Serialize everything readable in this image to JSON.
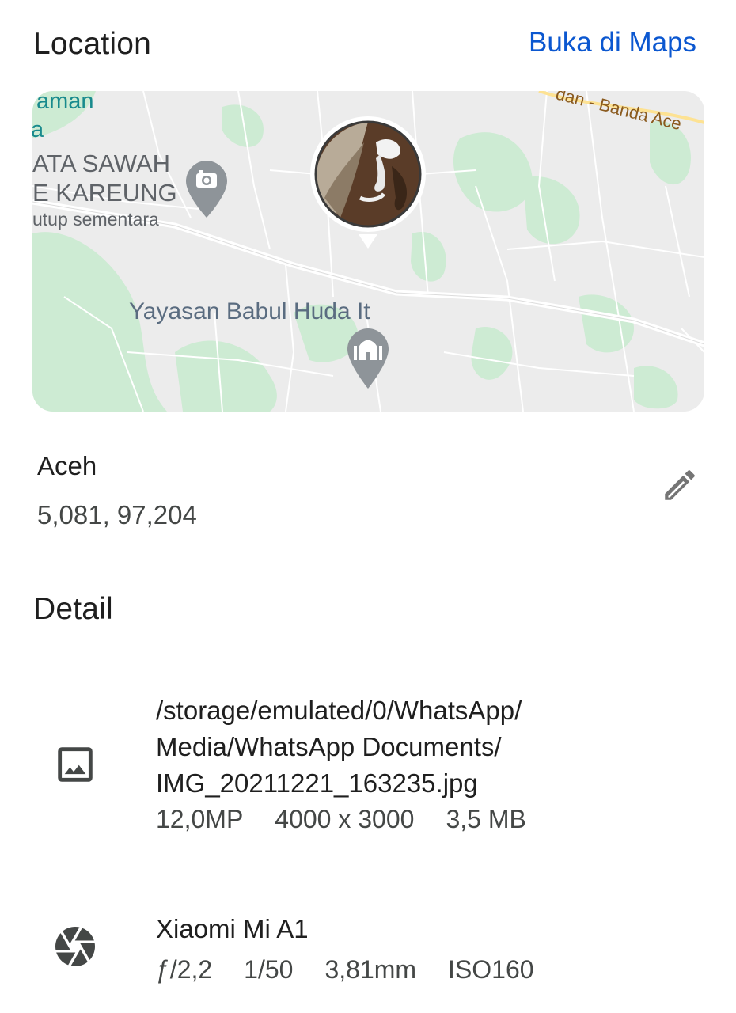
{
  "location": {
    "title": "Location",
    "open_maps_label": "Buka di Maps",
    "place_name": "Aceh",
    "coordinates": "5,081, 97,204",
    "map": {
      "labels": {
        "taman": "aman",
        "left_a": "a",
        "wisata_line1": "ATA SAWAH",
        "wisata_line2": "E KAREUNG",
        "wisata_status": "utup sementara",
        "yayasan": "Yayasan Babul Huda It",
        "road": "dan - Banda Ace"
      }
    }
  },
  "detail": {
    "title": "Detail",
    "file": {
      "path_line1": "/storage/emulated/0/WhatsApp/",
      "path_line2": "Media/WhatsApp Documents/",
      "path_line3": "IMG_20211221_163235.jpg",
      "megapixels": "12,0MP",
      "resolution": "4000 x 3000",
      "size": "3,5 MB"
    },
    "camera": {
      "model": "Xiaomi Mi A1",
      "aperture": "ƒ/2,2",
      "shutter": "1/50",
      "focal_length": "3,81mm",
      "iso": "ISO160"
    }
  },
  "colors": {
    "accent": "#0b57d0",
    "map_background": "#ececec",
    "map_green": "#c7ebcf",
    "map_pin_gray": "#8e9499"
  }
}
